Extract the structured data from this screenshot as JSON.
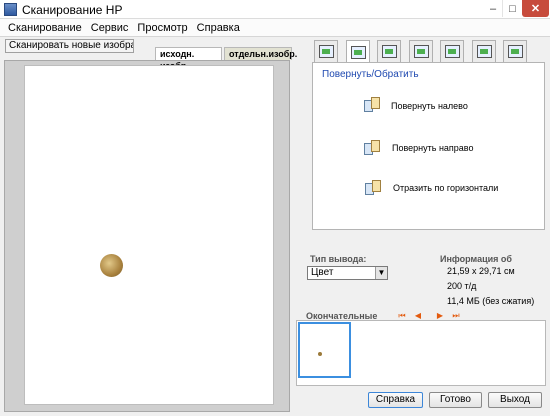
{
  "window": {
    "title": "Сканирование HP",
    "minimize": "–",
    "maximize": "□",
    "close": "✕"
  },
  "menu": [
    "Сканирование",
    "Сервис",
    "Просмотр",
    "Справка"
  ],
  "left": {
    "scan_new_label": "Сканировать новые изображения",
    "tabs": [
      "исходн. изобр.",
      "отдельн.изобр."
    ]
  },
  "tool_tabs": [
    {
      "icon": "adjust-image-icon"
    },
    {
      "icon": "rotate-flip-icon",
      "active": true
    },
    {
      "icon": "crop-icon"
    },
    {
      "icon": "resize-icon"
    },
    {
      "icon": "enhance-icon"
    },
    {
      "icon": "color-adjust-icon"
    },
    {
      "icon": "tools-icon"
    }
  ],
  "panel": {
    "title": "Повернуть/Обратить",
    "actions": [
      {
        "label": "Повернуть налево"
      },
      {
        "label": "Повернуть направо"
      },
      {
        "label": "Отразить по горизонтали"
      }
    ]
  },
  "output": {
    "label": "Тип вывода:",
    "value": "Цвет"
  },
  "info": {
    "title": "Информация об",
    "lines": [
      "21,59 x 29,71 см",
      "200 т/д",
      "11,4 МБ (без сжатия)"
    ]
  },
  "finals": {
    "label": "Окончательные",
    "nav": [
      "⏮",
      "◀",
      "▶",
      "⏭"
    ]
  },
  "buttons": {
    "help": "Справка",
    "done": "Готово",
    "exit": "Выход"
  },
  "colors": {
    "accent": "#1f49b0",
    "nav_orange": "#e35b0f",
    "selection": "#3b8fe0"
  }
}
